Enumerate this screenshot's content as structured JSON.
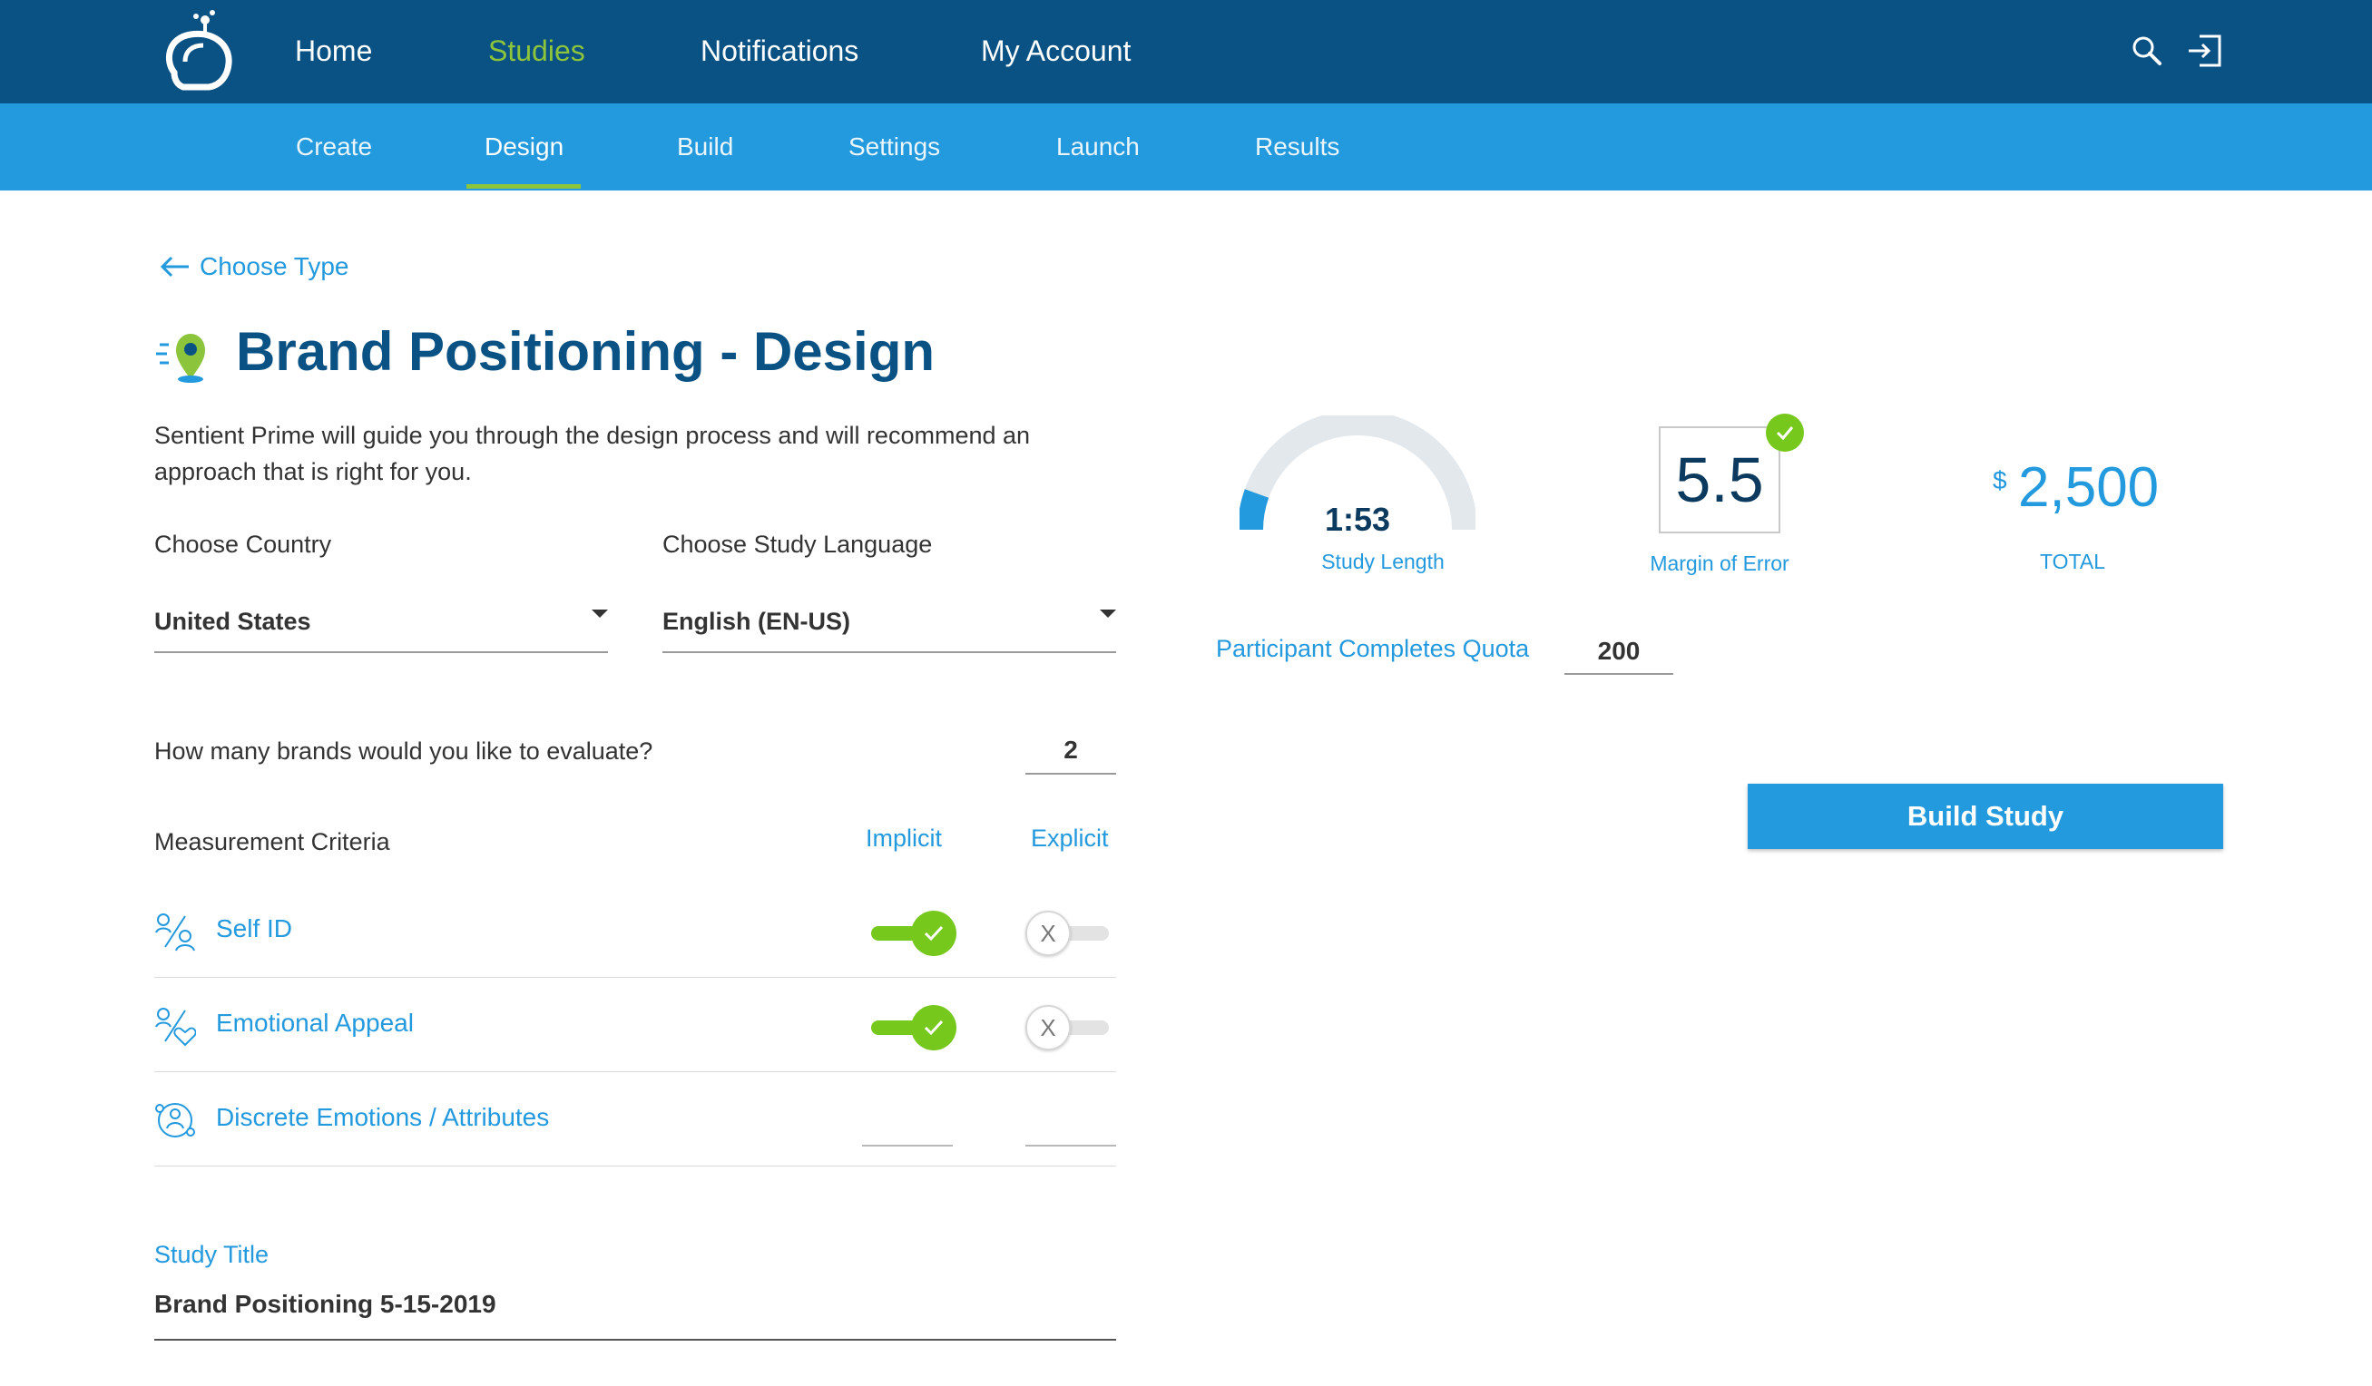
{
  "topnav": {
    "items": [
      {
        "label": "Home",
        "active": false
      },
      {
        "label": "Studies",
        "active": true
      },
      {
        "label": "Notifications",
        "active": false
      },
      {
        "label": "My Account",
        "active": false
      }
    ],
    "icons": [
      "search-icon",
      "logout-icon"
    ]
  },
  "subnav": {
    "items": [
      {
        "label": "Create",
        "active": false
      },
      {
        "label": "Design",
        "active": true
      },
      {
        "label": "Build",
        "active": false
      },
      {
        "label": "Settings",
        "active": false
      },
      {
        "label": "Launch",
        "active": false
      },
      {
        "label": "Results",
        "active": false
      }
    ]
  },
  "back_link": "Choose Type",
  "page_title": "Brand Positioning - Design",
  "intro": "Sentient Prime will guide you through the design process and will recommend an approach that is right for you.",
  "country": {
    "label": "Choose Country",
    "value": "United States"
  },
  "language": {
    "label": "Choose Study Language",
    "value": "English (EN-US)"
  },
  "brands": {
    "question": "How many brands would you like to evaluate?",
    "value": "2"
  },
  "criteria": {
    "label": "Measurement Criteria",
    "implicit_label": "Implicit",
    "explicit_label": "Explicit",
    "rows": [
      {
        "label": "Self ID",
        "implicit": true,
        "explicit": false
      },
      {
        "label": "Emotional Appeal",
        "implicit": true,
        "explicit": false
      },
      {
        "label": "Discrete Emotions / Attributes"
      }
    ],
    "off_symbol": "X"
  },
  "study_title": {
    "label": "Study Title",
    "value": "Brand Positioning 5-15-2019"
  },
  "metrics": {
    "study_length": {
      "value": "1:53",
      "label": "Study Length",
      "fill_fraction": 0.11
    },
    "margin_of_error": {
      "value": "5.5",
      "label": "Margin of Error"
    },
    "total": {
      "currency": "$",
      "value": "2,500",
      "label": "TOTAL"
    }
  },
  "quota": {
    "label": "Participant Completes Quota",
    "value": "200"
  },
  "build_button": "Build Study",
  "colors": {
    "topnav_bg": "#0b5284",
    "subnav_bg": "#2399de",
    "accent_blue": "#2399de",
    "accent_green": "#77c81c",
    "title_blue": "#0b5284"
  }
}
